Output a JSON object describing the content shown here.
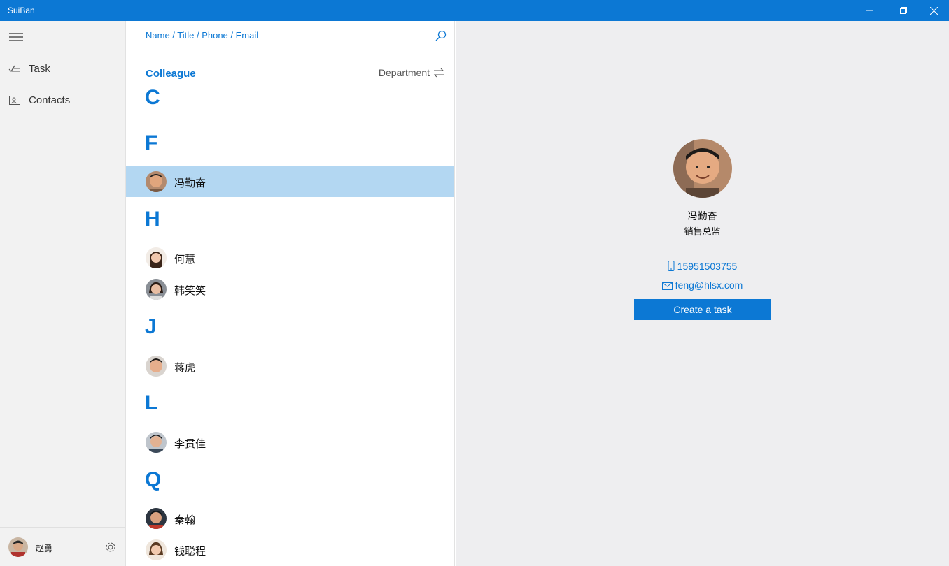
{
  "window": {
    "title": "SuiBan"
  },
  "nav": {
    "items": [
      {
        "label": "Task",
        "icon": "task-icon"
      },
      {
        "label": "Contacts",
        "icon": "contacts-icon"
      }
    ],
    "user": {
      "name": "赵勇"
    }
  },
  "search": {
    "placeholder": "Name / Title / Phone / Email"
  },
  "list": {
    "group_label": "Colleague",
    "sort_label": "Department",
    "sections": [
      {
        "letter": "C",
        "contacts": []
      },
      {
        "letter": "F",
        "contacts": [
          {
            "name": "冯勤奋",
            "selected": true
          }
        ]
      },
      {
        "letter": "H",
        "contacts": [
          {
            "name": "何慧"
          },
          {
            "name": "韩笑笑"
          }
        ]
      },
      {
        "letter": "J",
        "contacts": [
          {
            "name": "蒋虎"
          }
        ]
      },
      {
        "letter": "L",
        "contacts": [
          {
            "name": "李贯佳"
          }
        ]
      },
      {
        "letter": "Q",
        "contacts": [
          {
            "name": "秦翰"
          },
          {
            "name": "钱聪程"
          }
        ]
      }
    ]
  },
  "detail": {
    "name": "冯勤奋",
    "title": "销售总监",
    "phone": "15951503755",
    "email": "feng@hlsx.com",
    "create_task_label": "Create a task"
  },
  "colors": {
    "accent": "#0c78d4",
    "selected_row": "#b3d7f2",
    "detail_bg": "#eeeef0",
    "nav_bg": "#f2f2f2"
  }
}
